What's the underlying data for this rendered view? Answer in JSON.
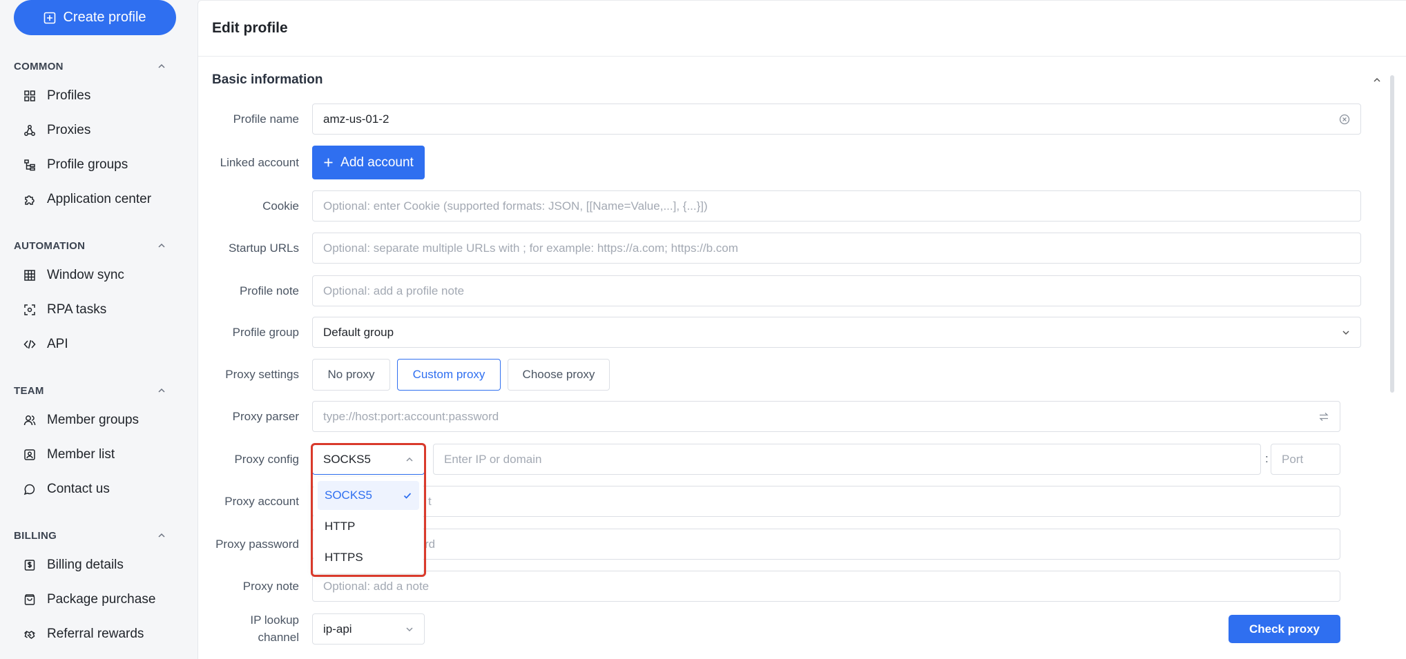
{
  "sidebar": {
    "create_label": "Create profile",
    "sections": {
      "common": "COMMON",
      "automation": "AUTOMATION",
      "team": "TEAM",
      "billing": "BILLING"
    },
    "items": {
      "profiles": "Profiles",
      "proxies": "Proxies",
      "profile_groups": "Profile groups",
      "application_center": "Application center",
      "window_sync": "Window sync",
      "rpa_tasks": "RPA tasks",
      "api": "API",
      "member_groups": "Member groups",
      "member_list": "Member list",
      "contact_us": "Contact us",
      "billing_details": "Billing details",
      "package_purchase": "Package purchase",
      "referral_rewards": "Referral rewards"
    }
  },
  "main": {
    "title": "Edit profile",
    "section": "Basic information",
    "labels": {
      "profile_name": "Profile name",
      "linked_account": "Linked account",
      "cookie": "Cookie",
      "startup_urls": "Startup URLs",
      "profile_note": "Profile note",
      "profile_group": "Profile group",
      "proxy_settings": "Proxy settings",
      "proxy_parser": "Proxy parser",
      "proxy_config": "Proxy config",
      "proxy_account": "Proxy account",
      "proxy_password": "Proxy password",
      "proxy_note": "Proxy note",
      "ip_lookup_1": "IP lookup",
      "ip_lookup_2": "channel"
    },
    "values": {
      "profile_name": "amz-us-01-2",
      "profile_group": "Default group",
      "proxy_type": "SOCKS5",
      "ip_lookup": "ip-api"
    },
    "placeholders": {
      "cookie": "Optional: enter Cookie (supported formats: JSON, [[Name=Value,...], {...}])",
      "startup_urls": "Optional: separate multiple URLs with ; for example: https://a.com; https://b.com",
      "profile_note": "Optional: add a profile note",
      "proxy_parser": "type://host:port:account:password",
      "ip_domain": "Enter IP or domain",
      "port": "Port",
      "proxy_account_tail": "t",
      "proxy_password_tail": "rd",
      "proxy_note": "Optional: add a note"
    },
    "buttons": {
      "add_account": "Add account",
      "no_proxy": "No proxy",
      "custom_proxy": "Custom proxy",
      "choose_proxy": "Choose proxy",
      "check_proxy": "Check proxy"
    },
    "colon": ":",
    "proxy_type_options": [
      "SOCKS5",
      "HTTP",
      "HTTPS"
    ],
    "selected_proxy_type": "SOCKS5"
  },
  "colors": {
    "accent": "#2f6ff0",
    "highlight": "#d93a2b"
  }
}
